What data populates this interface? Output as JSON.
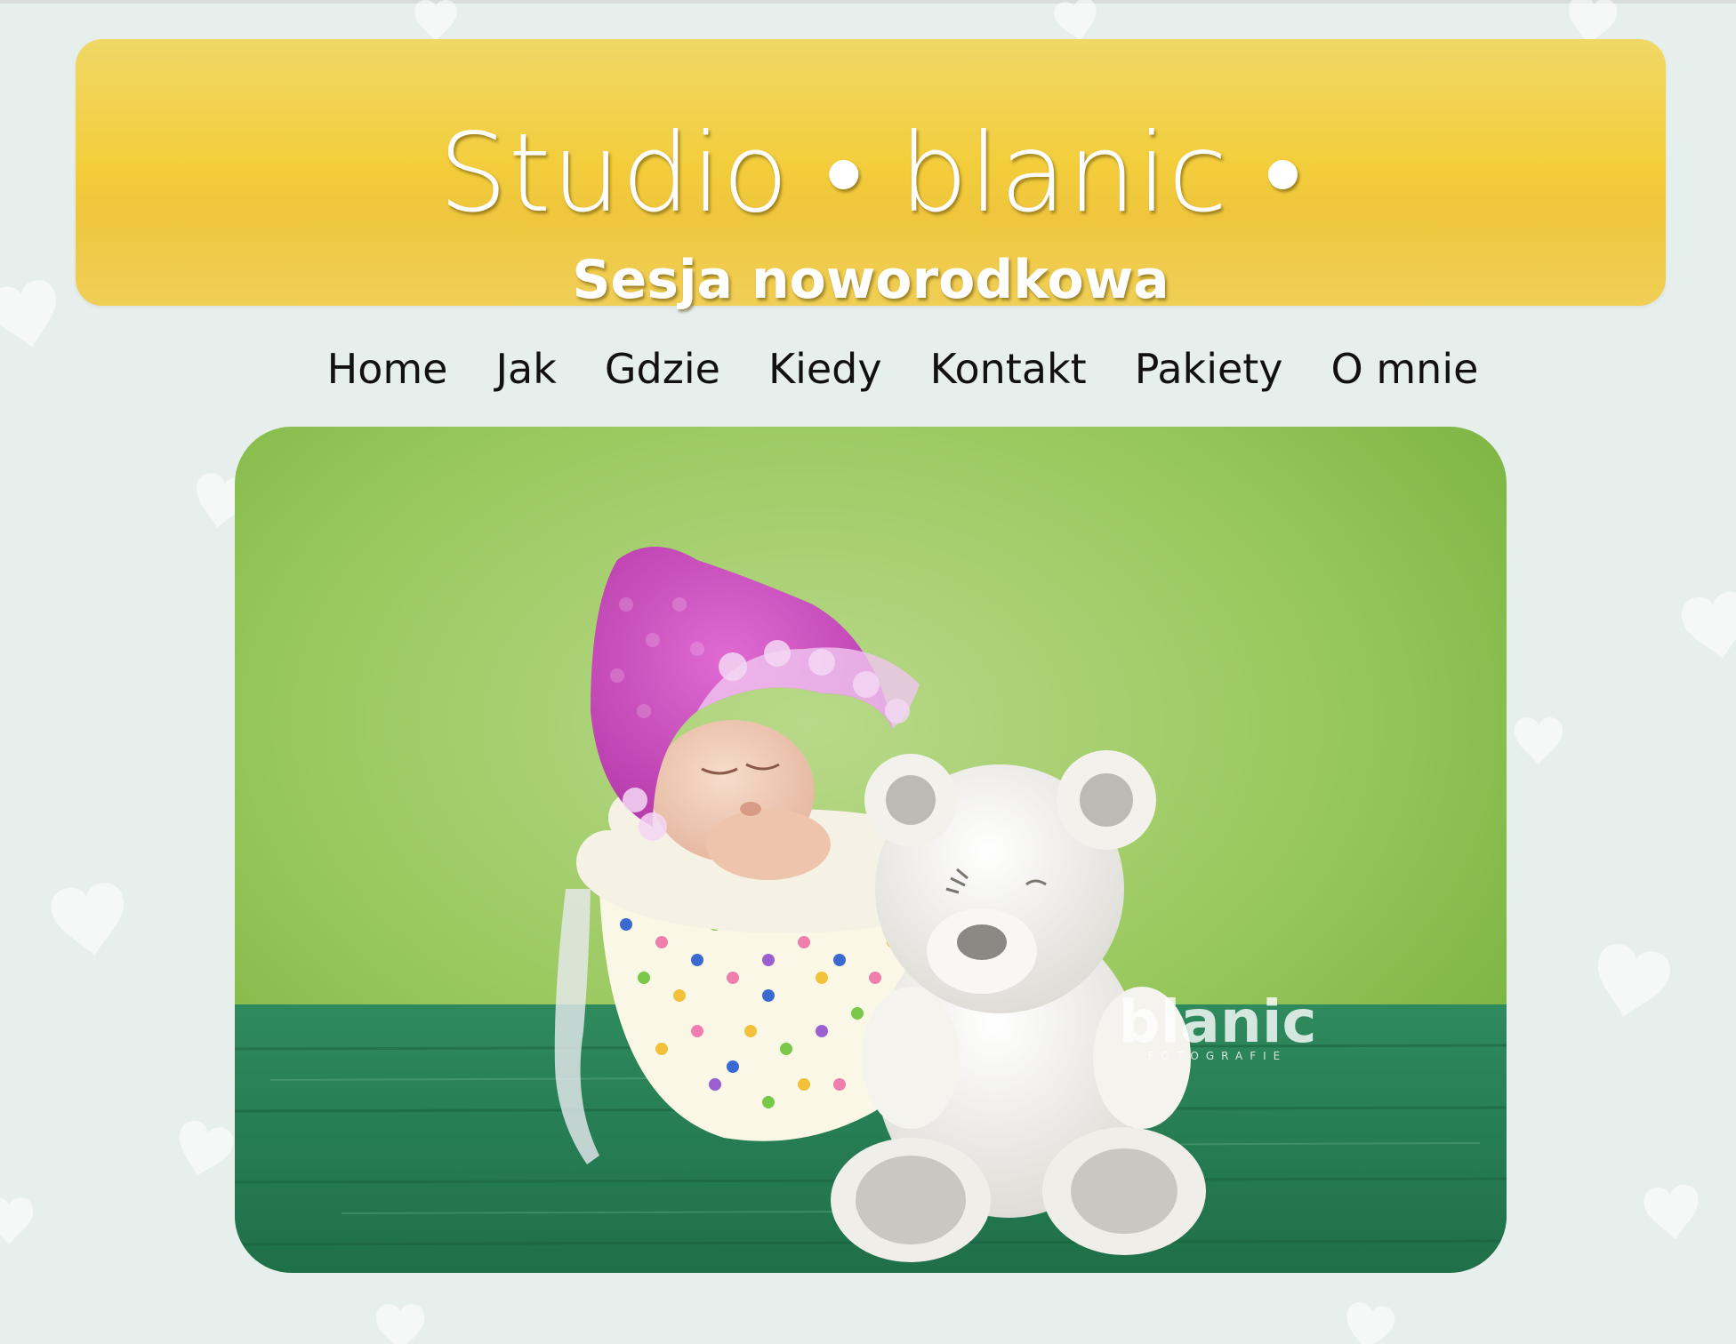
{
  "header": {
    "title": "Studio • blanic •",
    "subtitle": "Sesja noworodkowa"
  },
  "nav": {
    "items": [
      {
        "label": "Home"
      },
      {
        "label": "Jak"
      },
      {
        "label": "Gdzie"
      },
      {
        "label": "Kiedy"
      },
      {
        "label": "Kontakt"
      },
      {
        "label": "Pakiety"
      },
      {
        "label": "O mnie"
      }
    ]
  },
  "hero": {
    "watermark_name": "blanic",
    "watermark_tag": "FOTOGRAFIE"
  },
  "colors": {
    "page_background": "#e7efed",
    "banner_yellow": "#f3cd3b",
    "nav_text": "#111111",
    "photo_green_bg": "#98c85c",
    "photo_floor_green": "#2f8a5e"
  },
  "icons": [
    "heart-icon"
  ]
}
